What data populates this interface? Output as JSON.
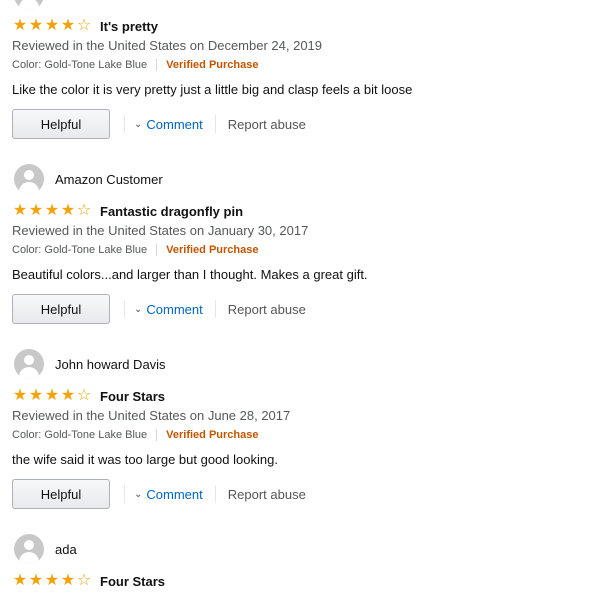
{
  "reviews": [
    {
      "title": "It's pretty",
      "rating": 4,
      "date_line": "Reviewed in the United States on December 24, 2019",
      "variant": "Color: Gold-Tone Lake Blue",
      "verified": "Verified Purchase",
      "body": "Like the color it is very pretty just a little big and clasp feels a bit loose",
      "helpful": "Helpful",
      "comment": "Comment",
      "report": "Report abuse"
    },
    {
      "profile": "Amazon Customer",
      "title": "Fantastic dragonfly pin",
      "rating": 4,
      "date_line": "Reviewed in the United States on January 30, 2017",
      "variant": "Color: Gold-Tone Lake Blue",
      "verified": "Verified Purchase",
      "body": "Beautiful colors...and larger than I thought. Makes a great gift.",
      "helpful": "Helpful",
      "comment": "Comment",
      "report": "Report abuse"
    },
    {
      "profile": "John howard Davis",
      "title": "Four Stars",
      "rating": 4,
      "date_line": "Reviewed in the United States on June 28, 2017",
      "variant": "Color: Gold-Tone Lake Blue",
      "verified": "Verified Purchase",
      "body": "the wife said it was too large but good looking.",
      "helpful": "Helpful",
      "comment": "Comment",
      "report": "Report abuse"
    },
    {
      "profile": "ada",
      "title": "Four Stars",
      "rating": 4
    }
  ],
  "colors": {
    "star": "#f4a20c",
    "verified": "#c45500",
    "link": "#0066c0"
  },
  "icons": {
    "avatar": "user-avatar-icon",
    "star": "star-icon",
    "chevron": "chevron-down-icon"
  }
}
